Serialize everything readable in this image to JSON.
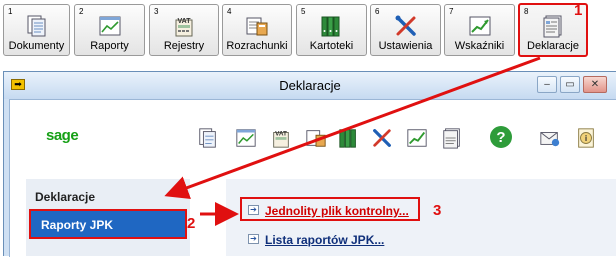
{
  "toolbar": {
    "buttons": [
      {
        "num": "1",
        "label": "Dokumenty",
        "icon": "documents-icon"
      },
      {
        "num": "2",
        "label": "Raporty",
        "icon": "chart-report-icon"
      },
      {
        "num": "3",
        "label": "Rejestry",
        "icon": "vat-register-icon"
      },
      {
        "num": "4",
        "label": "Rozrachunki",
        "icon": "settlements-icon"
      },
      {
        "num": "5",
        "label": "Kartoteki",
        "icon": "binders-icon"
      },
      {
        "num": "6",
        "label": "Ustawienia",
        "icon": "tools-icon"
      },
      {
        "num": "7",
        "label": "Wskaźniki",
        "icon": "growth-chart-icon"
      },
      {
        "num": "8",
        "label": "Deklaracje",
        "icon": "declaration-icon"
      }
    ]
  },
  "window": {
    "title": "Deklaracje",
    "logo": "sage",
    "controls": {
      "minimize": "–",
      "maximize": "▭",
      "close": "✕"
    },
    "quick_icons": [
      "documents-icon",
      "chart-report-icon",
      "vat-register-icon",
      "settlements-icon",
      "binders-icon",
      "tools-icon",
      "growth-chart-icon",
      "declaration-icon",
      "help-icon",
      "mail-icon",
      "info-icon"
    ],
    "help_symbol": "?",
    "info_symbol": "i"
  },
  "sidebar": {
    "heading": "Deklaracje",
    "selected_item": "Raporty JPK"
  },
  "content": {
    "links": [
      "Jednolity plik kontrolny...",
      "Lista raportów JPK..."
    ]
  },
  "annotations": {
    "one": "1",
    "two": "2",
    "three": "3"
  },
  "colors": {
    "highlight": "#e01010",
    "selected_bg": "#1f67c2",
    "link_red": "#d00000",
    "link_blue": "#0f2f7a",
    "sage_green": "#16a016"
  }
}
